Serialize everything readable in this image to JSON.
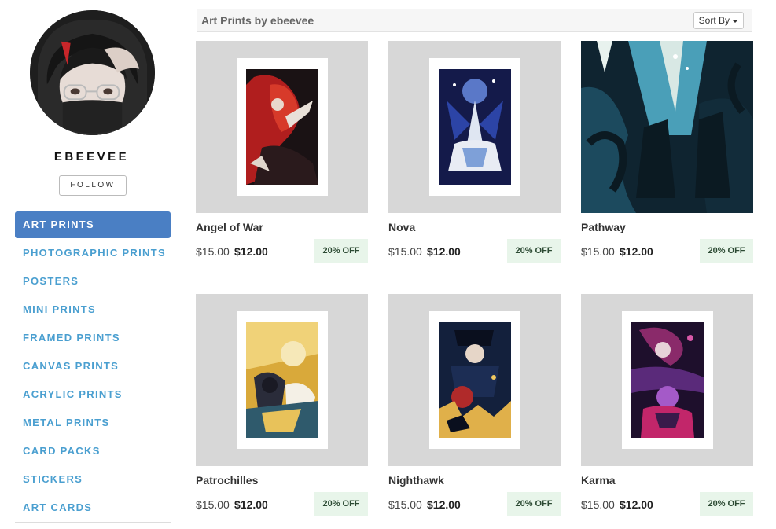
{
  "profile": {
    "username": "EBEEVEE",
    "follow_label": "FOLLOW"
  },
  "nav": {
    "items": [
      {
        "label": "ART PRINTS",
        "active": true
      },
      {
        "label": "PHOTOGRAPHIC PRINTS",
        "active": false
      },
      {
        "label": "POSTERS",
        "active": false
      },
      {
        "label": "MINI PRINTS",
        "active": false
      },
      {
        "label": "FRAMED PRINTS",
        "active": false
      },
      {
        "label": "CANVAS PRINTS",
        "active": false
      },
      {
        "label": "ACRYLIC PRINTS",
        "active": false
      },
      {
        "label": "METAL PRINTS",
        "active": false
      },
      {
        "label": "CARD PACKS",
        "active": false
      },
      {
        "label": "STICKERS",
        "active": false
      },
      {
        "label": "ART CARDS",
        "active": false
      }
    ]
  },
  "gallery": {
    "title": "Art Prints by ebeevee",
    "sort_label": "Sort By"
  },
  "products": [
    {
      "title": "Angel of War",
      "old_price": "$15.00",
      "price": "$12.00",
      "discount": "20% OFF"
    },
    {
      "title": "Nova",
      "old_price": "$15.00",
      "price": "$12.00",
      "discount": "20% OFF"
    },
    {
      "title": "Pathway",
      "old_price": "$15.00",
      "price": "$12.00",
      "discount": "20% OFF"
    },
    {
      "title": "Patrochilles",
      "old_price": "$15.00",
      "price": "$12.00",
      "discount": "20% OFF"
    },
    {
      "title": "Nighthawk",
      "old_price": "$15.00",
      "price": "$12.00",
      "discount": "20% OFF"
    },
    {
      "title": "Karma",
      "old_price": "$15.00",
      "price": "$12.00",
      "discount": "20% OFF"
    }
  ],
  "colors": {
    "nav_active_bg": "#4a7fc4",
    "nav_link": "#4a9fd0",
    "thumb_bg": "#d7d7d7",
    "discount_bg": "#e8f5ea",
    "discount_text": "#2c4a33"
  }
}
